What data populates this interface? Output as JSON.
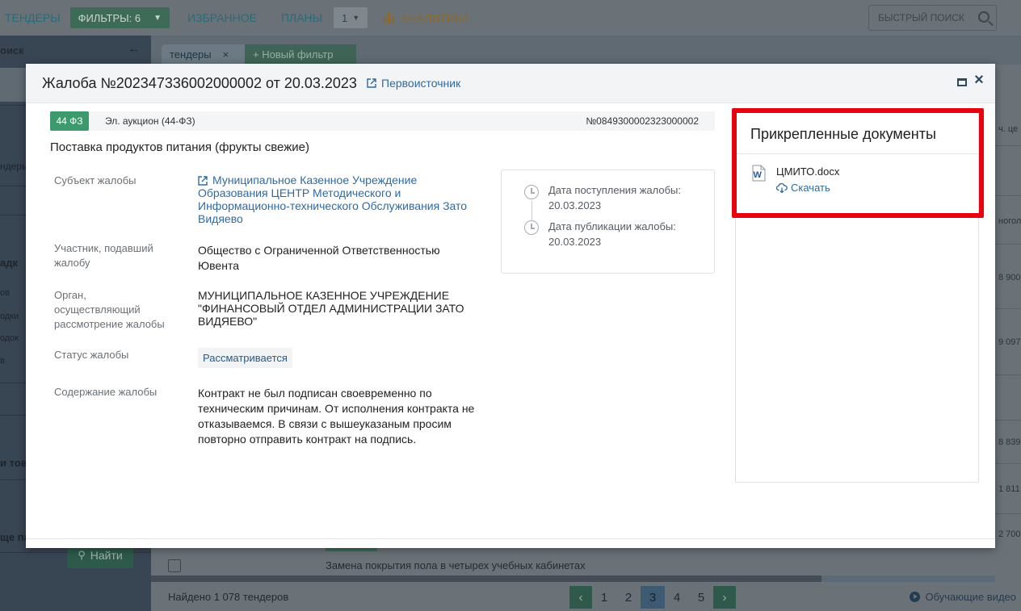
{
  "topbar": {
    "tenders": "ТЕНДЕРЫ",
    "filters": "ФИЛЬТРЫ: 6",
    "favorites": "ИЗБРАННОЕ",
    "plans": "ПЛАНЫ",
    "plans_num": "1",
    "analytics": "АНАЛИТИКА",
    "quick_search": "БЫСТРЫЙ ПОИСК"
  },
  "sidebar": {
    "title": "оиск",
    "labels": [
      "ндеры",
      "адк",
      "ов",
      "одки",
      "одок",
      "в",
      "и тов",
      "ще па"
    ],
    "find_button": "Найти"
  },
  "tabs": {
    "tab1": "тендеры",
    "tab2": "+ Новый фильтр"
  },
  "right_edge": {
    "header": "ч. це",
    "cells": [
      "ногол",
      "8 900",
      "9 097",
      "8 839",
      "1 811",
      "2 700"
    ]
  },
  "list": {
    "row_text": "Замена покрытия пола в четырех учебных  кабинетах"
  },
  "bottombar": {
    "found": "Найдено 1 078 тендеров",
    "pages": [
      "1",
      "2",
      "3",
      "4",
      "5"
    ],
    "active_page": "3",
    "videos": "Обучающие видео"
  },
  "modal": {
    "title": "Жалоба №202347336002000002 от 20.03.2023",
    "source_link": "Первоисточник",
    "badge": "44 ФЗ",
    "procedure_type": "Эл. аукцион (44-ФЗ)",
    "procedure_number": "№0849300002323000002",
    "subject": "Поставка продуктов питания (фрукты свежие)",
    "fields": {
      "subject_label": "Субъект жалобы",
      "subject_value": "Муниципальное Казенное Учреждение Образования ЦЕНТР Методического и Информационно-технического Обслуживания Зато Видяево",
      "participant_label": "Участник, подавший жалобу",
      "participant_value": "Общество с Ограниченной Ответственностью Ювента",
      "organ_label": "Орган, осуществляющий рассмотрение жалобы",
      "organ_value": "МУНИЦИПАЛЬНОЕ КАЗЕННОЕ УЧРЕЖДЕНИЕ \"ФИНАНСОВЫЙ ОТДЕЛ АДМИНИСТРАЦИИ ЗАТО ВИДЯЕВО\"",
      "status_label": "Статус жалобы",
      "status_value": "Рассматривается",
      "content_label": "Содержание жалобы",
      "content_value": "Контракт не был подписан своевременно по техническим причинам. От исполнения контракта не отказываемся. В связи с вышеуказаным просим повторно отправить контракт на подпись."
    },
    "dates": {
      "received_label": "Дата поступления жалобы:",
      "received_value": "20.03.2023",
      "published_label": "Дата публикации жалобы:",
      "published_value": "20.03.2023"
    },
    "documents": {
      "title": "Прикрепленные документы",
      "file_name": "ЦМИТО.docx",
      "download": "Скачать"
    }
  },
  "colors": {
    "accent_green": "#3d9a6c",
    "link_blue": "#2f6aa3",
    "highlight_red": "#e8040e"
  }
}
